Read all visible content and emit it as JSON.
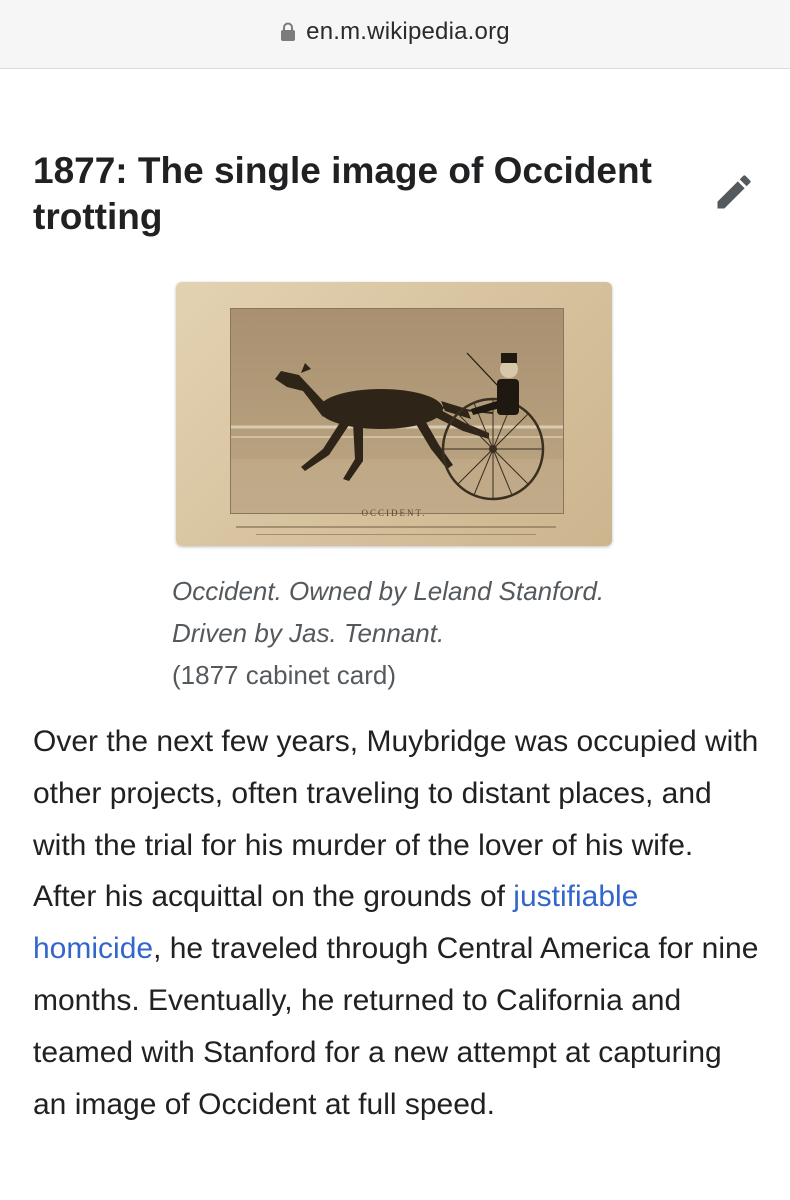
{
  "browser": {
    "url": "en.m.wikipedia.org",
    "lock_icon": "lock-icon"
  },
  "section": {
    "heading": "1877: The single image of Occident trotting",
    "edit_icon": "pencil-icon"
  },
  "figure": {
    "card_title": "OCCIDENT.",
    "caption_italic": "Occident. Owned by Leland Stanford. Driven by Jas. Tennant.",
    "caption_plain": "(1877 cabinet card)"
  },
  "paragraph": {
    "text_before": "Over the next few years, Muybridge was occupied with other projects, often traveling to distant places, and with the trial for his murder of the lover of his wife. After his acquittal on the grounds of ",
    "link_text": "justifiable homicide",
    "text_after": ", he traveled through Central America for nine months. Eventually, he returned to California and teamed with Stanford for a new attempt at capturing an image of Occident at full speed."
  },
  "colors": {
    "link": "#3366cc",
    "heading": "#202122",
    "caption": "#54595d",
    "url_bar": "#f6f6f7"
  }
}
